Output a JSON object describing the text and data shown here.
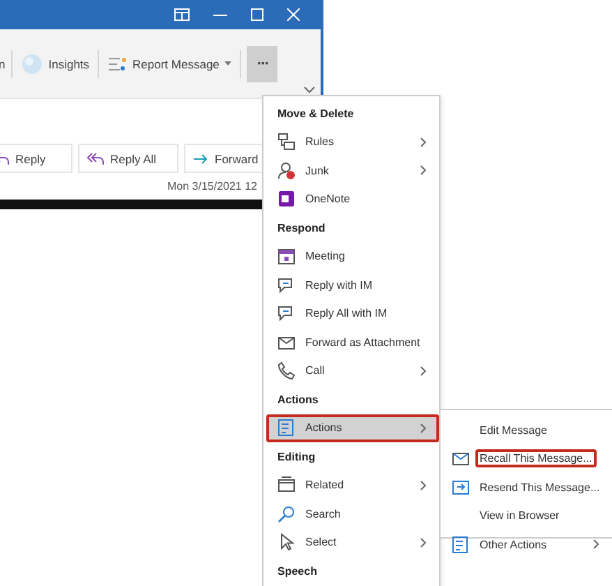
{
  "ribbon": {
    "cut_label": "n",
    "buttons": [
      {
        "label": "Insights",
        "kind": "button",
        "selected": false
      },
      {
        "label": "Report Message",
        "kind": "dropdown",
        "selected": false
      },
      {
        "label": "···",
        "kind": "more",
        "selected": true
      }
    ]
  },
  "message": {
    "actions": [
      {
        "label": "Reply"
      },
      {
        "label": "Reply All"
      },
      {
        "label": "Forward"
      }
    ],
    "date": "Mon 3/15/2021 12"
  },
  "menu": {
    "sections": [
      {
        "heading": "Move & Delete",
        "items": [
          {
            "label": "Rules",
            "submenu": true,
            "selected": false,
            "annotated": false
          },
          {
            "label": "Junk",
            "submenu": true,
            "selected": false,
            "annotated": false
          },
          {
            "label": "OneNote",
            "submenu": false,
            "selected": false,
            "annotated": false
          }
        ]
      },
      {
        "heading": "Respond",
        "items": [
          {
            "label": "Meeting",
            "submenu": false,
            "selected": false,
            "annotated": false
          },
          {
            "label": "Reply with IM",
            "submenu": false,
            "selected": false,
            "annotated": false
          },
          {
            "label": "Reply All with IM",
            "submenu": false,
            "selected": false,
            "annotated": false
          },
          {
            "label": "Forward as Attachment",
            "submenu": false,
            "selected": false,
            "annotated": false
          },
          {
            "label": "Call",
            "submenu": true,
            "selected": false,
            "annotated": false
          }
        ]
      },
      {
        "heading": "Actions",
        "items": [
          {
            "label": "Actions",
            "submenu": true,
            "selected": true,
            "annotated": true
          }
        ]
      },
      {
        "heading": "Editing",
        "items": [
          {
            "label": "Related",
            "submenu": true,
            "selected": false,
            "annotated": false
          },
          {
            "label": "Search",
            "submenu": false,
            "selected": false,
            "annotated": false
          },
          {
            "label": "Select",
            "submenu": true,
            "selected": false,
            "annotated": false
          }
        ]
      },
      {
        "heading": "Speech"
      }
    ]
  },
  "submenu": {
    "items": [
      {
        "label": "Edit Message",
        "submenu": false,
        "annotated": false
      },
      {
        "label": "Recall This Message...",
        "submenu": false,
        "annotated": true
      },
      {
        "label": "Resend This Message...",
        "submenu": false,
        "annotated": false
      },
      {
        "label": "View in Browser",
        "submenu": false,
        "annotated": false
      },
      {
        "label": "Other Actions",
        "submenu": true,
        "annotated": false
      }
    ]
  }
}
